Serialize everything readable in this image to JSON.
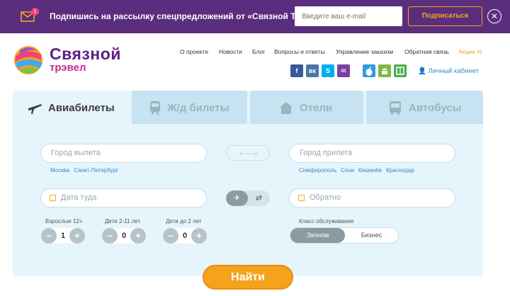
{
  "promo": {
    "badge_count": "1",
    "text": "Подпишись на рассылку спецпредложений от «Связной Трэвел»",
    "email_placeholder": "Введите ваш e-mail",
    "subscribe_label": "Подписаться",
    "close_glyph": "✕"
  },
  "logo": {
    "title": "Связной",
    "subtitle": "трэвел"
  },
  "nav": {
    "items": [
      "О проекте",
      "Новости",
      "Блог",
      "Вопросы и ответы",
      "Управление заказом",
      "Обратная связь"
    ],
    "promo_item": "Акции %"
  },
  "social": {
    "icons": [
      "facebook-icon",
      "vk-icon",
      "skype-icon",
      "email-icon",
      "apple-icon",
      "android-icon",
      "windows-icon"
    ],
    "labels": [
      "f",
      "вк",
      "S",
      "✉",
      "",
      "",
      ""
    ],
    "colors": [
      "#3b5998",
      "#4a76a8",
      "#00aff0",
      "#7b3fa0",
      "#2c9de0",
      "#7cba45",
      "#4cae4c"
    ]
  },
  "cabinet_label": "Личный кабинет",
  "tabs": [
    {
      "label": "Авиабилеты",
      "icon": "plane-icon",
      "active": true
    },
    {
      "label": "Ж/д билеты",
      "icon": "train-icon",
      "active": false
    },
    {
      "label": "Отели",
      "icon": "house-icon",
      "active": false
    },
    {
      "label": "Автобусы",
      "icon": "bus-icon",
      "active": false
    }
  ],
  "search": {
    "from_placeholder": "Город вылета",
    "to_placeholder": "Город прилета",
    "from_quick": [
      "Москва",
      "Санкт-Петербург"
    ],
    "to_quick": [
      "Симферополь",
      "Сочи",
      "Кишинёв",
      "Краснодар"
    ],
    "depart_placeholder": "Дата туда",
    "return_placeholder": "Обратно",
    "one_way_glyph": "✈",
    "round_trip_glyph": "⇄"
  },
  "passengers": [
    {
      "label": "Взрослые 12+",
      "value": "1"
    },
    {
      "label": "Дети 2-11 лет",
      "value": "0"
    },
    {
      "label": "Дети до 2 лет",
      "value": "0"
    }
  ],
  "stepper": {
    "minus": "–",
    "plus": "+"
  },
  "service_class": {
    "label": "Класс обслуживания",
    "economy": "Эконом",
    "business": "Бизнес"
  },
  "find_label": "Найти"
}
